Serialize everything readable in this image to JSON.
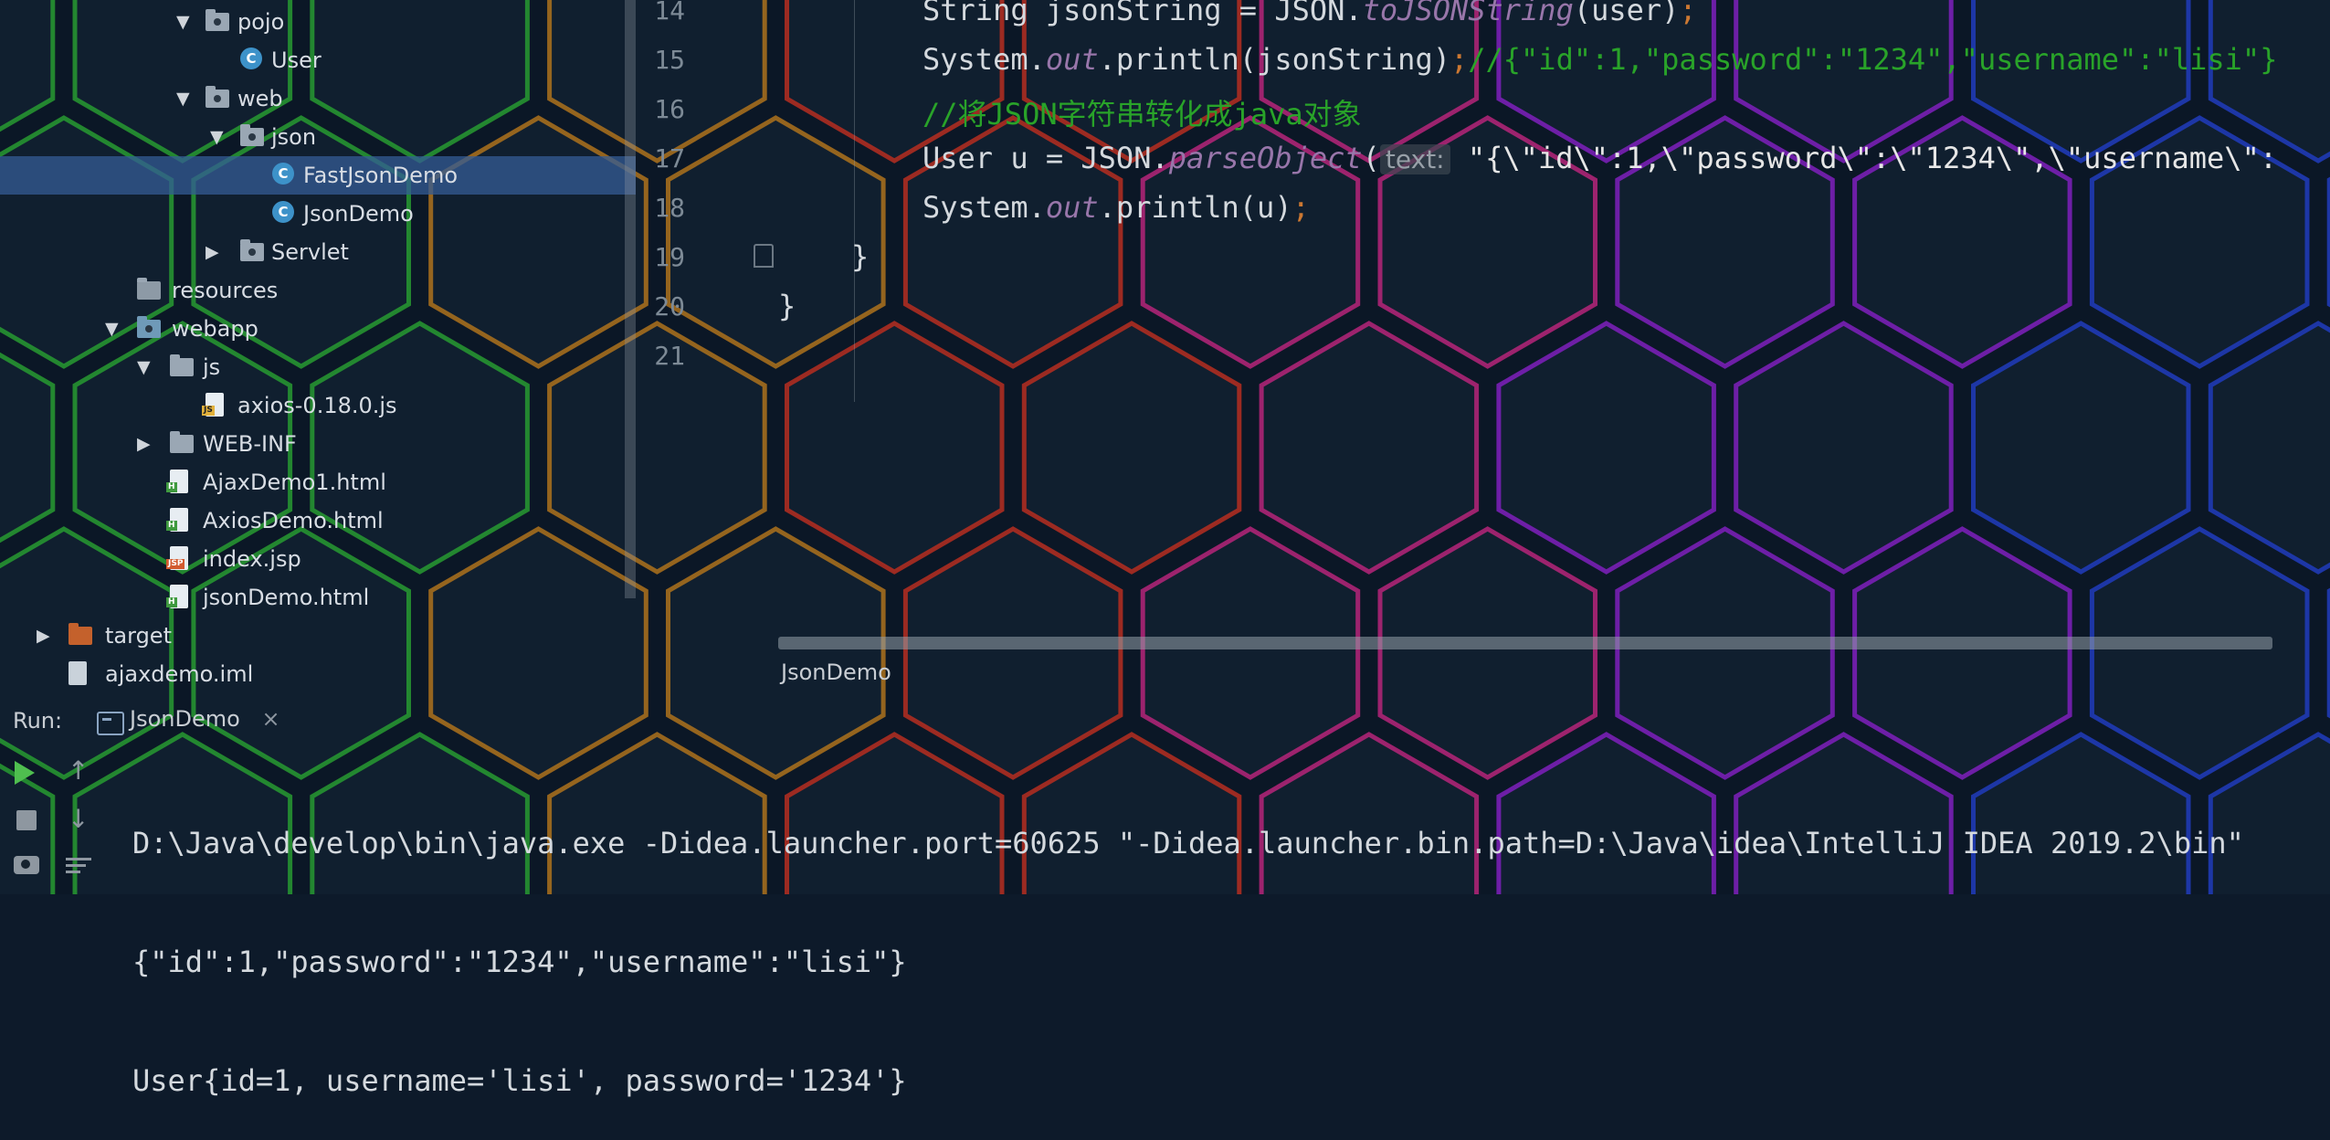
{
  "tree": {
    "items": [
      {
        "label": "pojo",
        "arrow": "▼",
        "icon": "folder-package-icon"
      },
      {
        "label": "User",
        "arrow": "",
        "icon": "class-icon"
      },
      {
        "label": "web",
        "arrow": "▼",
        "icon": "folder-package-icon"
      },
      {
        "label": "json",
        "arrow": "▼",
        "icon": "folder-package-icon"
      },
      {
        "label": "FastJsonDemo",
        "arrow": "",
        "icon": "class-icon",
        "selected": true
      },
      {
        "label": "JsonDemo",
        "arrow": "",
        "icon": "class-icon"
      },
      {
        "label": "Servlet",
        "arrow": "▶",
        "icon": "folder-package-icon"
      },
      {
        "label": "resources",
        "arrow": "",
        "icon": "resources-folder-icon"
      },
      {
        "label": "webapp",
        "arrow": "▼",
        "icon": "web-folder-icon"
      },
      {
        "label": "js",
        "arrow": "▼",
        "icon": "folder-icon"
      },
      {
        "label": "axios-0.18.0.js",
        "arrow": "",
        "icon": "js-file-icon"
      },
      {
        "label": "WEB-INF",
        "arrow": "▶",
        "icon": "folder-icon"
      },
      {
        "label": "AjaxDemo1.html",
        "arrow": "",
        "icon": "html-file-icon"
      },
      {
        "label": "AxiosDemo.html",
        "arrow": "",
        "icon": "html-file-icon"
      },
      {
        "label": "index.jsp",
        "arrow": "",
        "icon": "jsp-file-icon"
      },
      {
        "label": "jsonDemo.html",
        "arrow": "",
        "icon": "html-file-icon"
      },
      {
        "label": "target",
        "arrow": "▶",
        "icon": "target-folder-icon"
      },
      {
        "label": "ajaxdemo.iml",
        "arrow": "",
        "icon": "iml-file-icon"
      }
    ]
  },
  "editor": {
    "line_numbers": [
      "14",
      "15",
      "16",
      "17",
      "18",
      "19",
      "20",
      "21"
    ],
    "lines": {
      "l14": {
        "a": "String jsonString = JSON.",
        "b": "toJSONString",
        "c": "(user)",
        ";": ";"
      },
      "l15": {
        "a": "System.",
        "out": "out",
        "b": ".println(jsonString)",
        "semi": ";",
        "comment": "//{\"id\":1,\"password\":\"1234\",\"username\":\"lisi\"}"
      },
      "l16": {
        "comment": "//将JSON字符串转化成java对象"
      },
      "l17": {
        "a": "User u = JSON.",
        "b": "parseObject",
        "c": "(",
        "hint": "text:",
        "str": " \"{\\\"id\\\":1,\\\"password\\\":\\\"1234\\\",\\\"username\\\":"
      },
      "l18": {
        "a": "System.",
        "out": "out",
        "b": ".println(u)",
        "semi": ";"
      },
      "l19": {
        "a": "}"
      },
      "l20": {
        "a": "}"
      }
    },
    "breadcrumb": "JsonDemo"
  },
  "run": {
    "label": "Run:",
    "tab": "JsonDemo",
    "close": "×",
    "up": "↑",
    "down": "↓",
    "console": [
      "D:\\Java\\develop\\bin\\java.exe -Didea.launcher.port=60625 \"-Didea.launcher.bin.path=D:\\Java\\idea\\IntelliJ IDEA 2019.2\\bin\"",
      "{\"id\":1,\"password\":\"1234\",\"username\":\"lisi\"}",
      "User{id=1, username='lisi', password='1234'}"
    ]
  },
  "colors": {
    "keyword": "#cc7832",
    "method": "#ffc66d",
    "comment": "#29a329",
    "selection": "#345c96"
  }
}
